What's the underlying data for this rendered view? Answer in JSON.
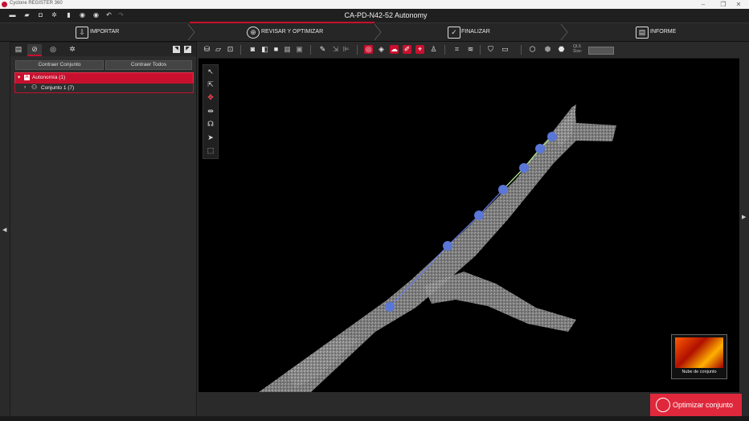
{
  "app": {
    "window_title": "Cyclone REGISTER 360",
    "document_title": "CA-PD-N42-52 Autonomy"
  },
  "workflow": {
    "steps": [
      {
        "label": "IMPORTAR",
        "icon": "import-icon"
      },
      {
        "label": "REVISAR Y OPTIMIZAR",
        "icon": "review-optimize-icon",
        "active": true
      },
      {
        "label": "FINALIZAR",
        "icon": "finalize-icon"
      },
      {
        "label": "INFORME",
        "icon": "report-icon"
      }
    ]
  },
  "left_panel": {
    "collapse_set_label": "Contraer Conjunto",
    "collapse_all_label": "Contraer Todos",
    "tree": [
      {
        "label": "Autonomía (1)",
        "selected": true
      },
      {
        "label": "Conjunto 1 (7)"
      }
    ]
  },
  "viewer_toolbar": {
    "size_label": "QLS Size:"
  },
  "thumbnail": {
    "label": "Nube de conjunto"
  },
  "actions": {
    "optimize_label": "Optimizar conjunto"
  },
  "colors": {
    "accent": "#c8102e",
    "link_line": "#6a7fe8",
    "link_line_bright": "#b6f07a",
    "node": "#5a76d6"
  }
}
